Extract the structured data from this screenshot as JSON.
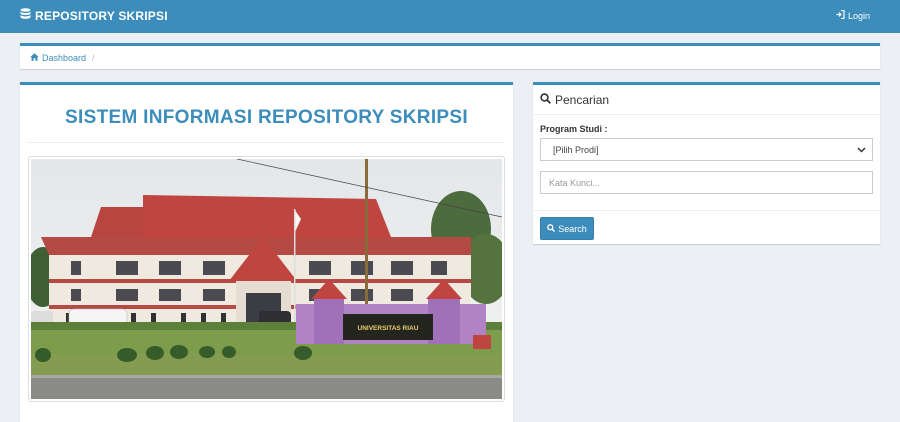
{
  "navbar": {
    "brand": "REPOSITORY SKRIPSI",
    "brand_icon": "database-icon",
    "login_label": "Login",
    "login_icon": "sign-in-icon",
    "color": "#3c8dbc"
  },
  "breadcrumb": {
    "home_label": "Dashboard",
    "home_icon": "home-icon",
    "separator": "/"
  },
  "main": {
    "title": "SISTEM INFORMASI REPOSITORY SKRIPSI",
    "photo_signboard": "UNIVERSITAS RIAU"
  },
  "search_panel": {
    "heading": "Pencarian",
    "heading_icon": "search-icon",
    "program_label": "Program Studi :",
    "program_selected": "[Pilih Prodi]",
    "keyword_placeholder": "Kata Kunci...",
    "keyword_value": "",
    "search_button": "Search"
  },
  "colors": {
    "accent": "#3c8dbc",
    "background": "#ecf0f5"
  }
}
